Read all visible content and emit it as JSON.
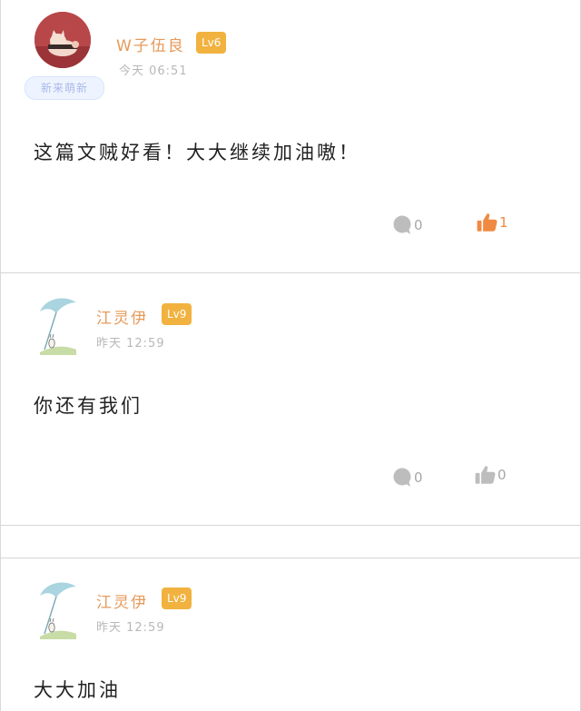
{
  "colors": {
    "name": "#e69a59",
    "level_badge": "#f2b23f",
    "liked": "#f08a42",
    "icon_gray": "#bdbdbd"
  },
  "comments": [
    {
      "user": "W子伍良",
      "level": "Lv6",
      "badge": "新来萌新",
      "time": "今天 06:51",
      "content": "这篇文贼好看！大大继续加油嗷！",
      "reply_count": "0",
      "like_count": "1",
      "liked": true,
      "avatar_icon": "avatar-cat-illustration-icon"
    },
    {
      "user": "江灵伊",
      "level": "Lv9",
      "time": "昨天 12:59",
      "content": "你还有我们",
      "reply_count": "0",
      "like_count": "0",
      "liked": false,
      "avatar_icon": "avatar-umbrella-illustration-icon"
    },
    {
      "user": "江灵伊",
      "level": "Lv9",
      "time": "昨天 12:59",
      "content": "大大加油",
      "avatar_icon": "avatar-umbrella-illustration-icon"
    }
  ]
}
